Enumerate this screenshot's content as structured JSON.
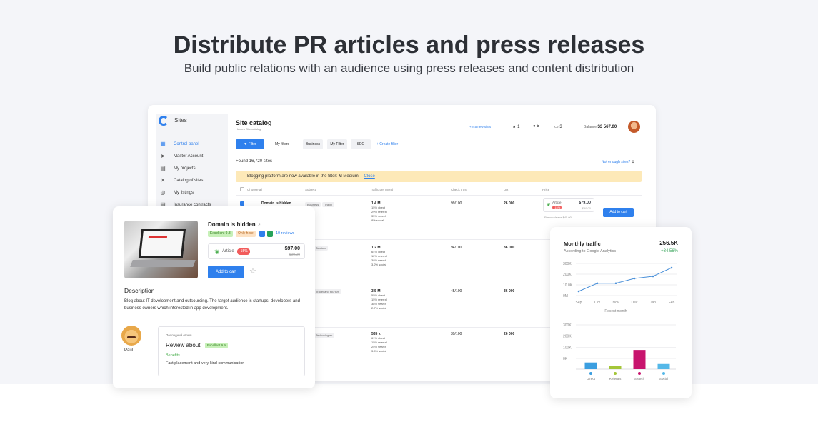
{
  "hero": {
    "title": "Distribute PR articles and press releases",
    "subtitle": "Build public relations with an audience using press releases and content distribution"
  },
  "dashboard": {
    "logo_text": "Sites",
    "sidebar": [
      {
        "label": "Control panel",
        "icon": "grid-icon",
        "active": true
      },
      {
        "label": "Master Account",
        "icon": "send-icon"
      },
      {
        "label": "My projects",
        "icon": "doc-icon"
      },
      {
        "label": "Catalog of sites",
        "icon": "tools-icon"
      },
      {
        "label": "My listings",
        "icon": "headset-icon"
      },
      {
        "label": "Insurance contracts",
        "icon": "doc-icon"
      }
    ],
    "title": "Site catalog",
    "breadcrumb": "Home  •  Site catalog",
    "new_sites_link": "+245 new sites",
    "stats": {
      "favorites": "1",
      "messages": "5",
      "cart": "3"
    },
    "balance_label": "Balance",
    "balance_value": "$3 567.00",
    "filters": {
      "filter": "Filter",
      "my_filters": "My filters",
      "business": "Business",
      "my_filter": "My Filter",
      "seo": "SEO",
      "create": "+ Create filter"
    },
    "found": "Found 16,720 sites",
    "not_enough": "Not enough sites?",
    "banner_text": "Blogging platform are now available in the filter:",
    "banner_platform": "Medium",
    "banner_close": "Close",
    "columns": [
      "Choose all",
      "Subject",
      "Traffic per month",
      "Check trust",
      "DR",
      "Price"
    ],
    "rows": [
      {
        "domain": "Domain is hidden",
        "tags": [
          "Business",
          "Travel"
        ],
        "traffic": "1.4 M",
        "direct": "15% direct",
        "referral": "29% referral",
        "search": "35% search",
        "social": "8% social",
        "trust": "99/100",
        "dr": "26 000",
        "offer": "Article",
        "discount": "-15%",
        "price": "$79.00",
        "old_price": "$99.00",
        "press": "Press release",
        "press_price": "$45.00",
        "cart": "Add to cart"
      },
      {
        "tags": [
          "Tourism"
        ],
        "traffic": "1.2 M",
        "direct": "64% direct",
        "referral": "12% referral",
        "search": "38% search",
        "social": "3.2% social",
        "trust": "94/100",
        "dr": "36 000"
      },
      {
        "tags": [
          "Travel and tourism"
        ],
        "traffic": "3.5 M",
        "direct": "55% direct",
        "referral": "15% referral",
        "search": "38% search",
        "social": "2.7% social",
        "trust": "45/100",
        "dr": "36 000"
      },
      {
        "tags": [
          "Technologies"
        ],
        "traffic": "535 k",
        "direct": "61% direct",
        "referral": "15% referral",
        "search": "25% search",
        "social": "3.5% social",
        "trust": "39/100",
        "dr": "26 000"
      }
    ]
  },
  "site_card": {
    "domain": "Domain is hidden",
    "rating_badge": "Excellent 9.8",
    "only_here": "Only here",
    "reviews": "10 reviews",
    "offer_type": "Article",
    "discount": "-15%",
    "price": "$97.00",
    "old_price": "$99.00",
    "add_to_cart": "Add to cart",
    "description_title": "Description",
    "description": "Blog about IT development and outsourcing. The target audience is startups, developers and business owners which interested in app development.",
    "reviewer": "Paul",
    "review_label": "Последний отзыв",
    "review_title": "Review about",
    "review_badge": "Excellent 9.9",
    "benefits_label": "Benefits",
    "review_text": "Fast placement and very kind communication"
  },
  "traffic_card": {
    "title": "Monthly traffic",
    "value": "256.5K",
    "subtitle": "According to Google Analytics",
    "change": "+34.56%",
    "line_chart": {
      "type": "line",
      "x": [
        "Sep",
        "Oct",
        "Nov",
        "Dec",
        "Jan",
        "Feb"
      ],
      "yticks": [
        "300K",
        "200K",
        "10.0K",
        "0M"
      ],
      "values": [
        40,
        115,
        115,
        160,
        180,
        260
      ],
      "ylim": [
        0,
        300
      ],
      "xlabel": "Recent month"
    },
    "bar_chart": {
      "type": "bar",
      "categories": [
        "Direct",
        "Referals",
        "Search",
        "Social"
      ],
      "yticks": [
        "300K",
        "200K",
        "100K",
        "0K"
      ],
      "values": [
        45,
        20,
        130,
        35
      ],
      "ylim": [
        0,
        300
      ],
      "colors": [
        "#3b9ee0",
        "#a4c639",
        "#c8146e",
        "#55b8e8"
      ]
    }
  }
}
